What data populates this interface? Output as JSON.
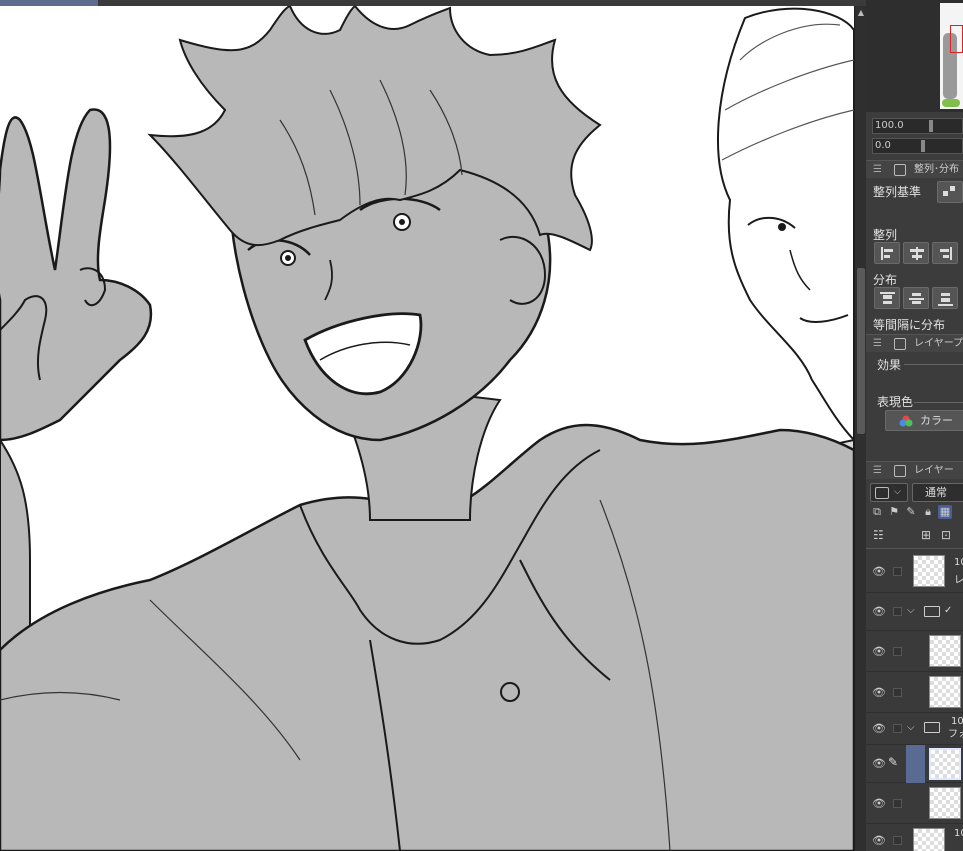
{
  "panel": {
    "opacity_value": "100.0",
    "offset_value": "0.0",
    "align_section_title": "整列･分布",
    "align_basis_label": "整列基準",
    "align_label": "整列",
    "distribute_label": "分布",
    "equal_spacing_label": "等間隔に分布",
    "layer_property_title": "レイヤープロパ",
    "effect_label": "効果",
    "expression_color_label": "表現色",
    "color_button_label": "カラー",
    "layer_panel_title": "レイヤー",
    "blend_mode": "通常"
  },
  "layers": [
    {
      "label_top": "10",
      "label_bottom": "レ"
    },
    {
      "label_top": "",
      "label_bottom": ""
    },
    {
      "label_top": "",
      "label_bottom": ""
    },
    {
      "label_top": "",
      "label_bottom": ""
    },
    {
      "label_top": "10",
      "label_bottom": "フォ"
    },
    {
      "label_top": "",
      "label_bottom": ""
    },
    {
      "label_top": "",
      "label_bottom": ""
    },
    {
      "label_top": "10",
      "label_bottom": ""
    }
  ],
  "colors": {
    "canvas_bg": "#ffffff",
    "fill_gray": "#b8b8b8",
    "fill_light": "#dcdcdc",
    "line": "#1a1a1a",
    "panel_bg": "#3c3c3c",
    "accent": "#5d6b8e"
  }
}
